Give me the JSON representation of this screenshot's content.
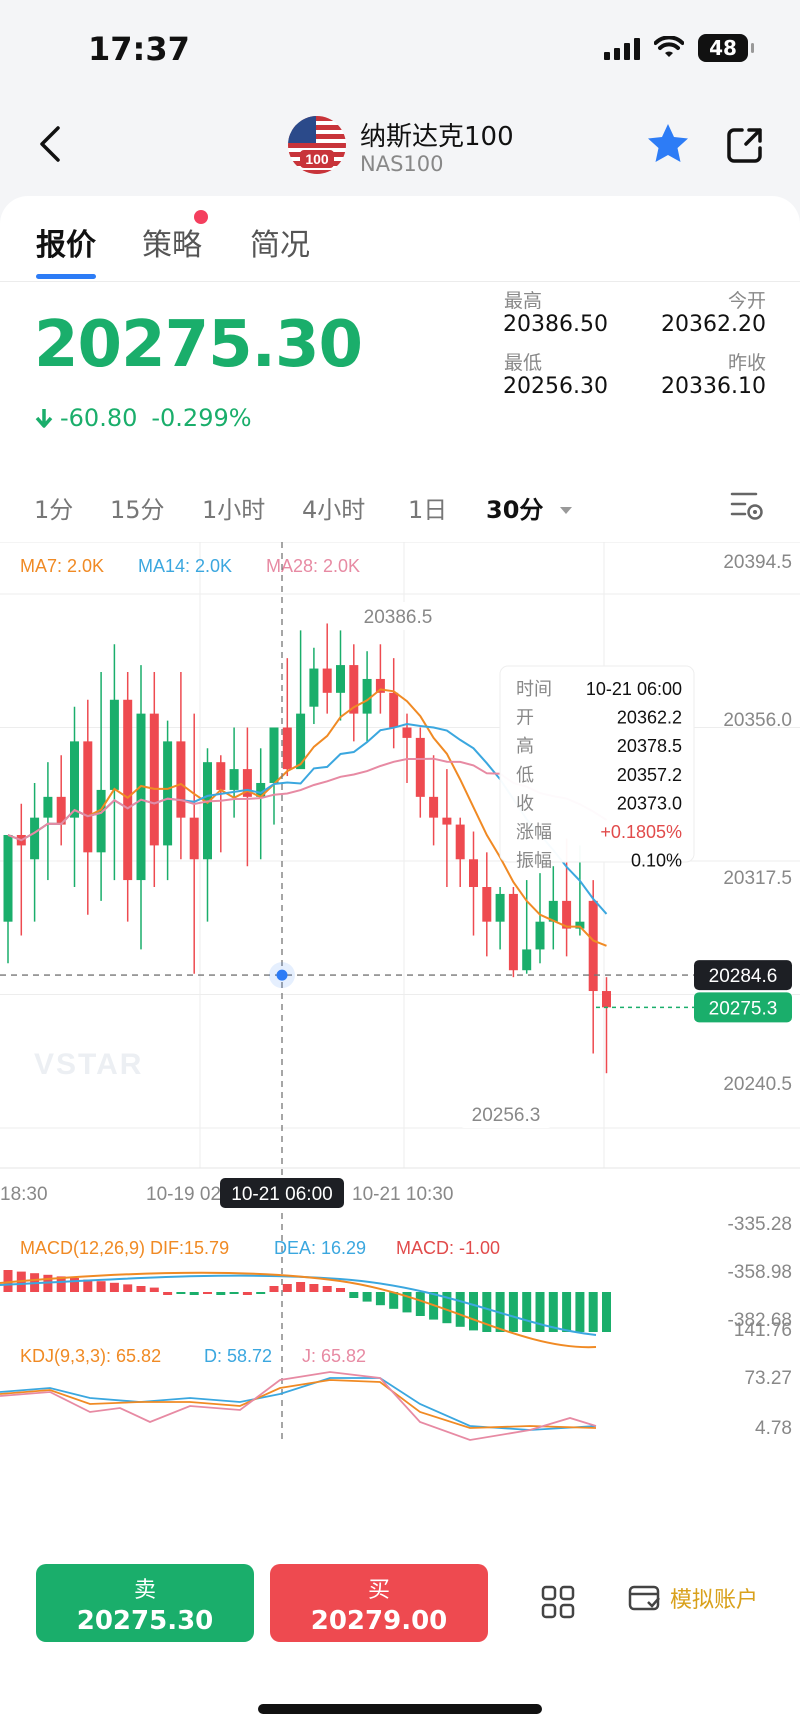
{
  "status": {
    "time": "17:37",
    "battery": "48"
  },
  "header": {
    "name": "纳斯达克100",
    "symbol": "NAS100",
    "flag_badge": "100"
  },
  "tabs": [
    {
      "label": "报价",
      "active": true
    },
    {
      "label": "策略",
      "active": false,
      "badge": true
    },
    {
      "label": "简况",
      "active": false
    }
  ],
  "quote": {
    "price": "20275.30",
    "change": "-60.80",
    "change_pct": "-0.299%",
    "high_label": "最高",
    "high": "20386.50",
    "open_label": "今开",
    "open": "20362.20",
    "low_label": "最低",
    "low": "20256.30",
    "prev_close_label": "昨收",
    "prev_close": "20336.10"
  },
  "periods": [
    {
      "label": "1分",
      "active": false
    },
    {
      "label": "15分",
      "active": false
    },
    {
      "label": "1小时",
      "active": false
    },
    {
      "label": "4小时",
      "active": false
    },
    {
      "label": "1日",
      "active": false
    },
    {
      "label": "30分",
      "active": true
    }
  ],
  "chart_data": {
    "type": "candlestick",
    "ma_legend": [
      {
        "label": "MA7: 2.0K",
        "color": "#f08a24"
      },
      {
        "label": "MA14: 2.0K",
        "color": "#3ba7df"
      },
      {
        "label": "MA28: 2.0K",
        "color": "#e78aa3"
      }
    ],
    "y_ticks": [
      "20394.5",
      "20356.0",
      "20317.5",
      "20240.5"
    ],
    "ylim": [
      20240.5,
      20394.5
    ],
    "x_ticks": [
      "18:30",
      "10-19 02",
      "10-21 10:30"
    ],
    "crosshair": {
      "time": "10-21 06:00",
      "price": "20284.6"
    },
    "current_price_tag": "20275.3",
    "max_marker": "20386.5",
    "min_marker": "20256.3",
    "watermark": "VSTAR",
    "tooltip": [
      {
        "label": "时间",
        "value": "10-21 06:00"
      },
      {
        "label": "开",
        "value": "20362.2"
      },
      {
        "label": "高",
        "value": "20378.5"
      },
      {
        "label": "低",
        "value": "20357.2"
      },
      {
        "label": "收",
        "value": "20373.0"
      },
      {
        "label": "涨幅",
        "value": "+0.1805%"
      },
      {
        "label": "振幅",
        "value": "0.10%"
      }
    ],
    "candles": [
      [
        20300,
        20325,
        20325,
        20288
      ],
      [
        20325,
        20322,
        20334,
        20296
      ],
      [
        20318,
        20330,
        20340,
        20300
      ],
      [
        20330,
        20336,
        20346,
        20312
      ],
      [
        20336,
        20328,
        20348,
        20322
      ],
      [
        20330,
        20352,
        20362,
        20310
      ],
      [
        20352,
        20320,
        20364,
        20302
      ],
      [
        20320,
        20338,
        20372,
        20306
      ],
      [
        20338,
        20364,
        20380,
        20312
      ],
      [
        20364,
        20312,
        20372,
        20300
      ],
      [
        20312,
        20360,
        20374,
        20292
      ],
      [
        20360,
        20322,
        20372,
        20310
      ],
      [
        20322,
        20352,
        20358,
        20312
      ],
      [
        20352,
        20330,
        20372,
        20318
      ],
      [
        20330,
        20318,
        20360,
        20285
      ],
      [
        20318,
        20346,
        20350,
        20300
      ],
      [
        20346,
        20338,
        20348,
        20320
      ],
      [
        20338,
        20344,
        20356,
        20330
      ],
      [
        20344,
        20336,
        20356,
        20316
      ],
      [
        20336,
        20340,
        20350,
        20318
      ],
      [
        20340,
        20356,
        20352,
        20328
      ],
      [
        20356,
        20344,
        20376,
        20342
      ],
      [
        20344,
        20360,
        20384,
        20346
      ],
      [
        20362,
        20373,
        20379,
        20357
      ],
      [
        20373,
        20366,
        20386,
        20360
      ],
      [
        20366,
        20374,
        20384,
        20358
      ],
      [
        20374,
        20360,
        20380,
        20352
      ],
      [
        20360,
        20370,
        20378,
        20352
      ],
      [
        20370,
        20366,
        20380,
        20360
      ],
      [
        20366,
        20356,
        20376,
        20350
      ],
      [
        20356,
        20353,
        20360,
        20340
      ],
      [
        20353,
        20336,
        20356,
        20330
      ],
      [
        20336,
        20330,
        20348,
        20322
      ],
      [
        20330,
        20328,
        20344,
        20310
      ],
      [
        20328,
        20318,
        20330,
        20310
      ],
      [
        20318,
        20310,
        20326,
        20296
      ],
      [
        20310,
        20300,
        20320,
        20290
      ],
      [
        20300,
        20308,
        20310,
        20292
      ],
      [
        20308,
        20286,
        20310,
        20284
      ],
      [
        20286,
        20292,
        20312,
        20285
      ],
      [
        20292,
        20300,
        20314,
        20288
      ],
      [
        20300,
        20306,
        20316,
        20292
      ],
      [
        20306,
        20298,
        20324,
        20290
      ],
      [
        20298,
        20300,
        20322,
        20296
      ],
      [
        20306,
        20280,
        20312,
        20262
      ],
      [
        20280,
        20275.3,
        20284,
        20256.3
      ]
    ],
    "macd": {
      "legend": [
        {
          "label": "MACD(12,26,9) DIF:15.79",
          "color": "#f08a24"
        },
        {
          "label": "DEA: 16.29",
          "color": "#3ba7df"
        },
        {
          "label": "MACD: -1.00",
          "color": "#e14b4b"
        }
      ],
      "y_ticks": [
        "-335.28",
        "-358.98",
        "-382.68"
      ]
    },
    "kdj": {
      "legend": [
        {
          "label": "KDJ(9,3,3): 65.82",
          "color": "#f08a24"
        },
        {
          "label": "D: 58.72",
          "color": "#3ba7df"
        },
        {
          "label": "J: 65.82",
          "color": "#e78aa3"
        }
      ],
      "y_ticks": [
        "141.76",
        "73.27",
        "4.78"
      ]
    }
  },
  "trade": {
    "sell_label": "卖",
    "sell_price": "20275.30",
    "buy_label": "买",
    "buy_price": "20279.00",
    "demo_label": "模拟账户"
  }
}
